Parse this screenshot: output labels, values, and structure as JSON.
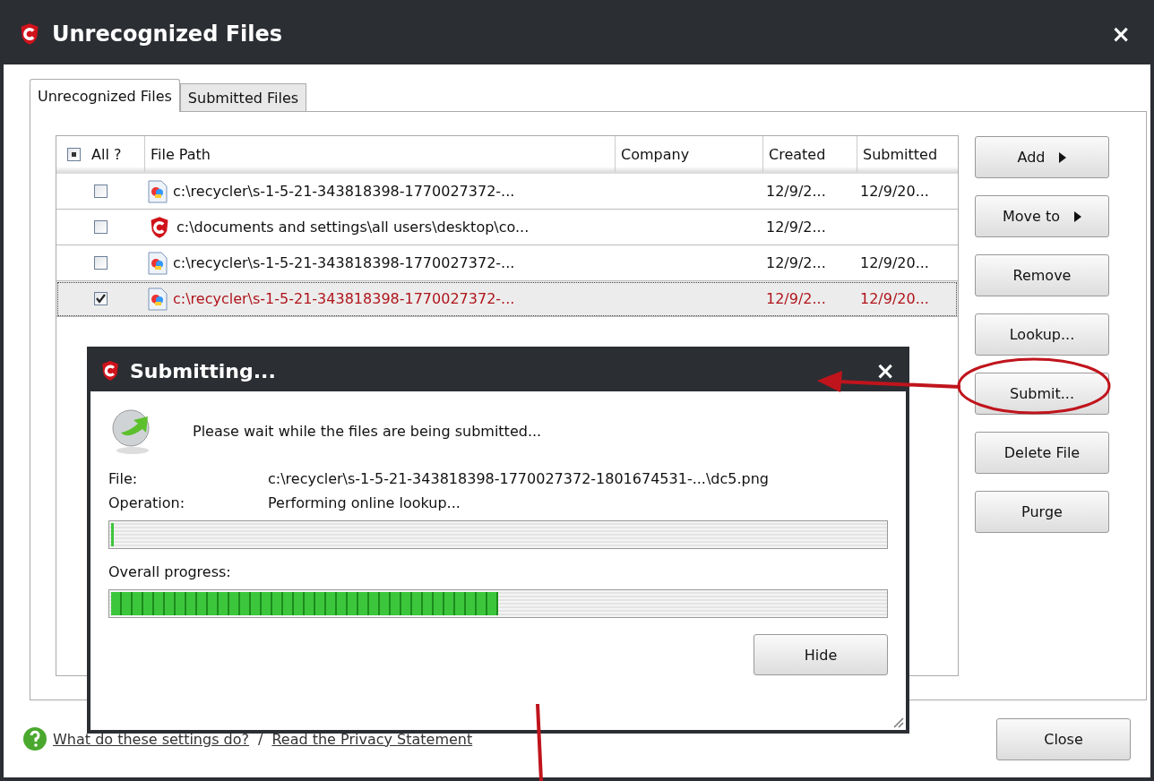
{
  "window": {
    "title": "Unrecognized Files",
    "close": "×"
  },
  "tabs": [
    {
      "label": "Unrecognized Files",
      "selected": true
    },
    {
      "label": "Submitted Files",
      "selected": false
    }
  ],
  "table": {
    "all_checkbox": {
      "label": "All ?",
      "partial": true
    },
    "columns": [
      "File Path",
      "Company",
      "Created",
      "Submitted"
    ],
    "rows": [
      {
        "checked": false,
        "selected": false,
        "kind": "image",
        "path": "c:\\recycler\\s-1-5-21-343818398-1770027372-...",
        "company": "",
        "created": "12/9/2...",
        "submitted": "12/9/20..."
      },
      {
        "checked": false,
        "selected": false,
        "kind": "app",
        "path": "c:\\documents and settings\\all users\\desktop\\co...",
        "company": "",
        "created": "12/9/2...",
        "submitted": ""
      },
      {
        "checked": false,
        "selected": false,
        "kind": "image",
        "path": "c:\\recycler\\s-1-5-21-343818398-1770027372-...",
        "company": "",
        "created": "12/9/2...",
        "submitted": "12/9/20..."
      },
      {
        "checked": true,
        "selected": true,
        "kind": "image",
        "path": "c:\\recycler\\s-1-5-21-343818398-1770027372-...",
        "company": "",
        "created": "12/9/2...",
        "submitted": "12/9/20..."
      }
    ]
  },
  "side_buttons": [
    {
      "label": "Add",
      "menu": true
    },
    {
      "label": "Move to",
      "menu": true
    },
    {
      "label": "Remove",
      "menu": false
    },
    {
      "label": "Lookup...",
      "menu": false
    },
    {
      "label": "Submit...",
      "menu": false
    },
    {
      "label": "Delete File",
      "menu": false
    },
    {
      "label": "Purge",
      "menu": false
    }
  ],
  "footer": {
    "links": [
      "What do these settings do?",
      "Read the Privacy Statement"
    ],
    "separator": "/",
    "close_button": "Close"
  },
  "dialog": {
    "title": "Submitting...",
    "close": "×",
    "message": "Please wait while the files are being submitted...",
    "fields": [
      {
        "label": "File:",
        "value": "c:\\recycler\\s-1-5-21-343818398-1770027372-1801674531-...\\dc5.png"
      },
      {
        "label": "Operation:",
        "value": "Performing online lookup..."
      }
    ],
    "operation_progress": {
      "level": 0
    },
    "overall_label": "Overall progress:",
    "overall_progress": {
      "level": 0.5
    },
    "hide_button": "Hide"
  }
}
